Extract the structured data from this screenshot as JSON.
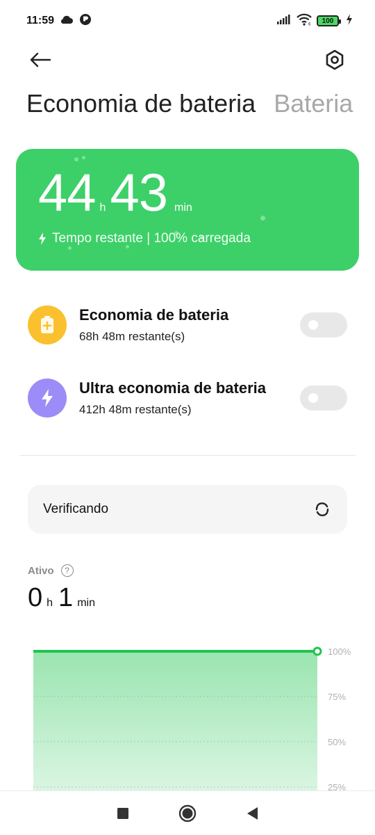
{
  "status_bar": {
    "time": "11:59",
    "battery": "100",
    "icons": [
      "cloud-icon",
      "app-notification-icon",
      "signal-icon",
      "wifi-icon",
      "battery-icon",
      "charging-icon"
    ]
  },
  "header": {
    "back_icon": "back-arrow-icon",
    "settings_icon": "settings-icon"
  },
  "tabs": [
    {
      "label": "Economia de bateria",
      "active": true
    },
    {
      "label": "Bateria",
      "active": false
    }
  ],
  "hero": {
    "hours": "44",
    "hours_unit": "h",
    "minutes": "43",
    "minutes_unit": "min",
    "subtitle": "Tempo restante | 100% carregada",
    "bg_color": "#3dd068"
  },
  "modes": [
    {
      "title": "Economia de bateria",
      "remaining": "68h 48m restante(s)",
      "icon": "battery-plus-icon",
      "icon_color": "#fbc02d",
      "enabled": false
    },
    {
      "title": "Ultra economia de bateria",
      "remaining": "412h 48m restante(s)",
      "icon": "lightning-icon",
      "icon_color": "#9b8cf7",
      "enabled": false
    }
  ],
  "checking": {
    "label": "Verificando",
    "icon": "refresh-icon"
  },
  "active": {
    "label": "Ativo",
    "hours": "0",
    "hours_unit": "h",
    "minutes": "1",
    "minutes_unit": "min"
  },
  "chart_data": {
    "type": "area",
    "title": "",
    "xlabel": "",
    "ylabel": "",
    "ylim": [
      0,
      100
    ],
    "y_ticks": [
      "100%",
      "75%",
      "50%",
      "25%"
    ],
    "y_tick_values": [
      100,
      75,
      50,
      25
    ],
    "series": [
      {
        "values": [
          100,
          100
        ]
      }
    ],
    "color": "#1fc44f",
    "grid": true
  },
  "navbar": {
    "items": [
      "recents-icon",
      "home-icon",
      "back-icon"
    ]
  }
}
